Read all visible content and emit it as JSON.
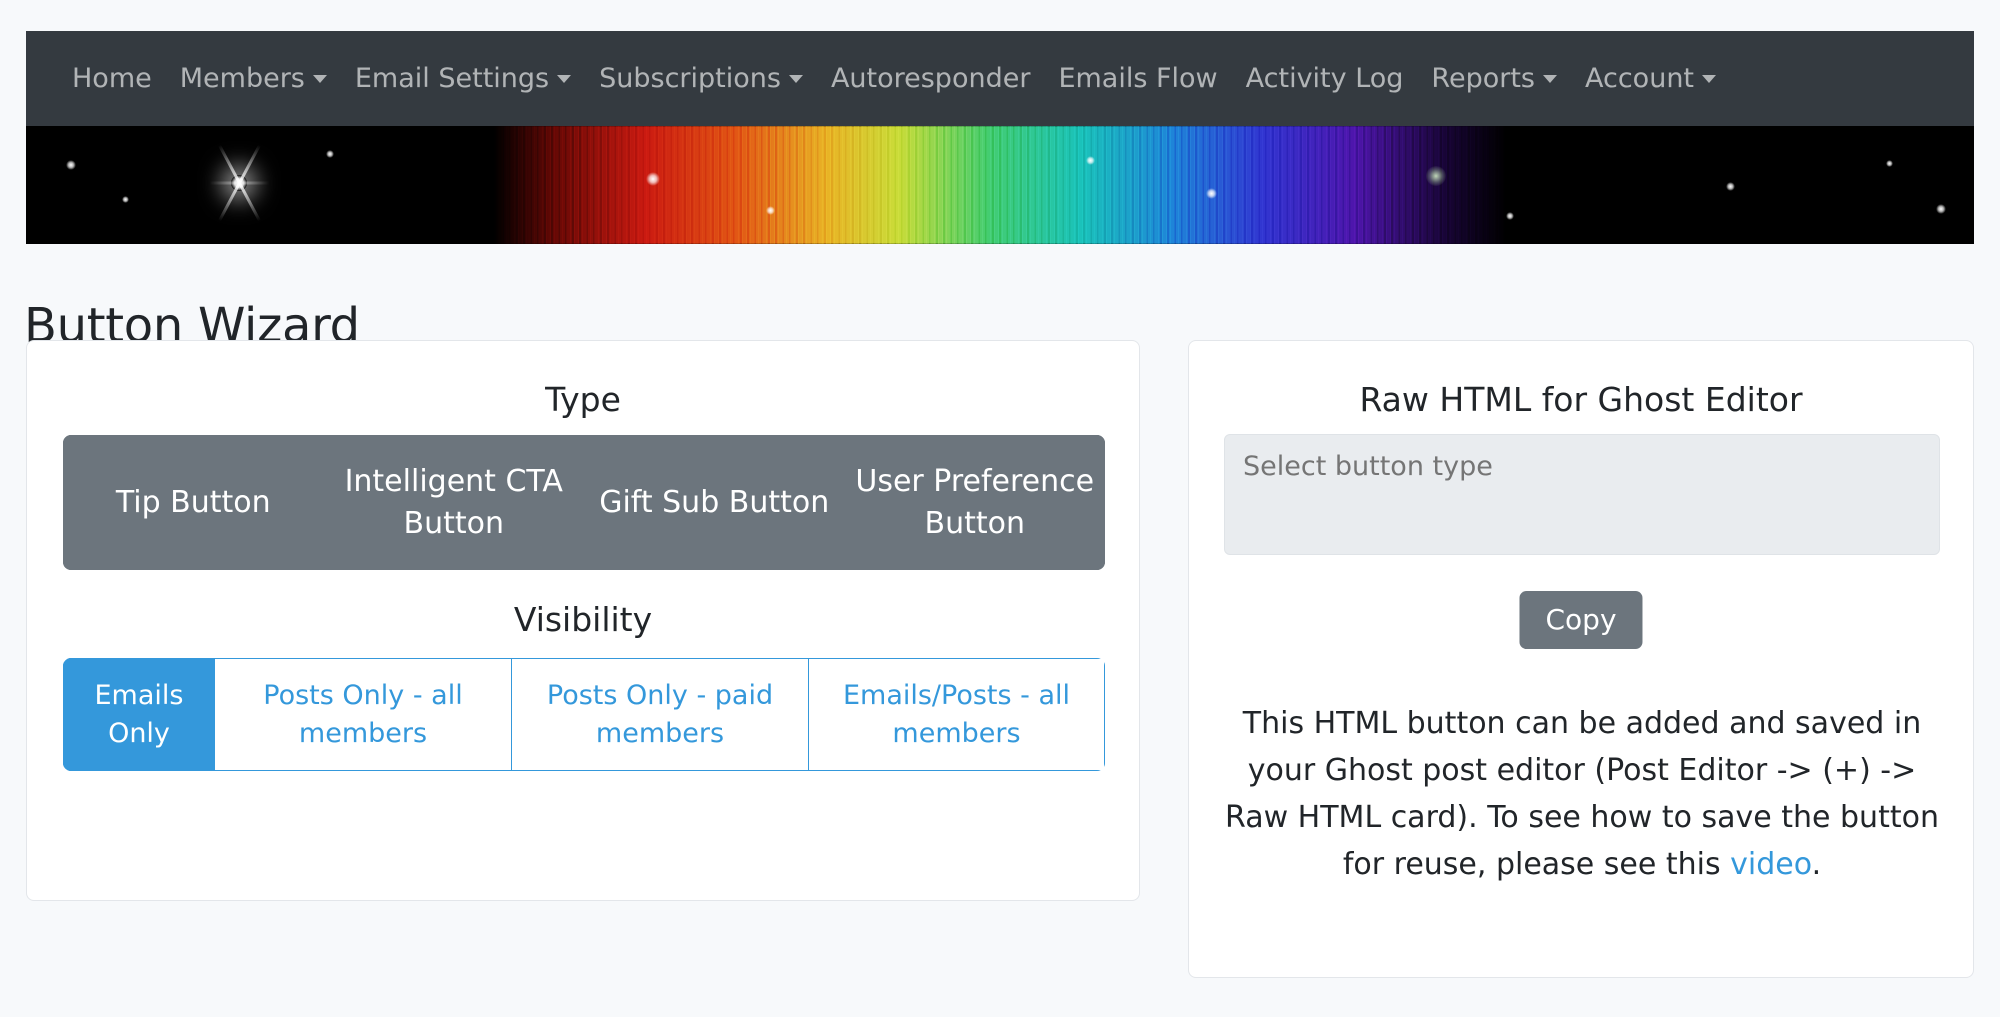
{
  "navbar": {
    "items": [
      {
        "label": "Home",
        "has_caret": false
      },
      {
        "label": "Members",
        "has_caret": true
      },
      {
        "label": "Email Settings",
        "has_caret": true
      },
      {
        "label": "Subscriptions",
        "has_caret": true
      },
      {
        "label": "Autoresponder",
        "has_caret": false
      },
      {
        "label": "Emails Flow",
        "has_caret": false
      },
      {
        "label": "Activity Log",
        "has_caret": false
      },
      {
        "label": "Reports",
        "has_caret": true
      },
      {
        "label": "Account",
        "has_caret": true
      }
    ]
  },
  "banner": {
    "alt": "space nebula rainbow spectrum banner"
  },
  "page": {
    "title": "Button Wizard"
  },
  "left_card": {
    "type_heading": "Type",
    "type_buttons": [
      {
        "label": "Tip Button",
        "selected": false
      },
      {
        "label": "Intelligent CTA Button",
        "selected": false
      },
      {
        "label": "Gift Sub Button",
        "selected": false
      },
      {
        "label": "User Preference Button",
        "selected": false
      }
    ],
    "visibility_heading": "Visibility",
    "visibility_buttons": [
      {
        "label": "Emails Only",
        "selected": true
      },
      {
        "label": "Posts Only - all members",
        "selected": false
      },
      {
        "label": "Posts Only - paid members",
        "selected": false
      },
      {
        "label": "Emails/Posts - all members",
        "selected": false
      }
    ]
  },
  "right_card": {
    "heading": "Raw HTML for Ghost Editor",
    "output_placeholder": "Select button type",
    "output_value": "",
    "copy_label": "Copy",
    "help_text_before": "This HTML button can be added and saved in your Ghost post editor (Post Editor -> (+) -> Raw HTML card). To see how to save the button for reuse, please see this ",
    "help_link_label": "video",
    "help_text_after": "."
  },
  "colors": {
    "navbar_bg": "#343a40",
    "accent_blue": "#3498db",
    "secondary_gray": "#6c757d",
    "page_bg": "#f7f9fb",
    "disabled_field": "#e9ecef"
  }
}
